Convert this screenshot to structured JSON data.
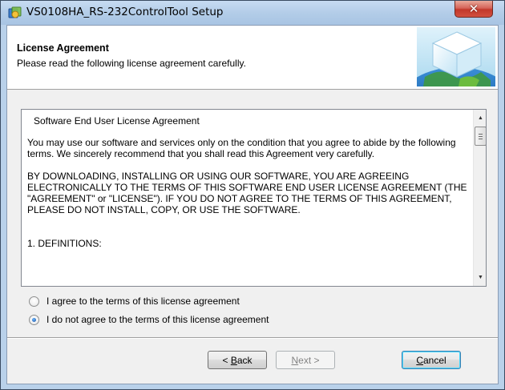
{
  "window": {
    "title": "VS0108HA_RS-232ControlTool Setup",
    "close_glyph": "✕"
  },
  "header": {
    "title": "License Agreement",
    "subtitle": "Please read the following license agreement carefully."
  },
  "license": {
    "heading": "Software End User License Agreement",
    "paragraph1": "You may use our software and services only on the condition that you agree to abide by the following terms. We sincerely recommend that you shall read this Agreement very carefully.",
    "paragraph2": "BY DOWNLOADING, INSTALLING OR USING OUR SOFTWARE, YOU ARE AGREEING ELECTRONICALLY TO THE TERMS OF THIS SOFTWARE END USER LICENSE AGREEMENT (THE \"AGREEMENT\" or \"LICENSE\"). IF YOU DO NOT AGREE TO THE TERMS OF THIS AGREEMENT, PLEASE DO NOT INSTALL, COPY, OR USE THE SOFTWARE.",
    "section1": "1. DEFINITIONS:"
  },
  "options": {
    "agree_label": "I agree to the terms of this license agreement",
    "disagree_label": "I do not agree to the terms of this license agreement",
    "selected": "disagree"
  },
  "buttons": {
    "back_prefix": "< ",
    "back_mnemonic": "B",
    "back_rest": "ack",
    "next_mnemonic": "N",
    "next_rest": "ext >",
    "cancel_mnemonic": "C",
    "cancel_rest": "ancel"
  },
  "icons": {
    "app": "installer-icon",
    "header_graphic": "cube-globe-graphic"
  }
}
